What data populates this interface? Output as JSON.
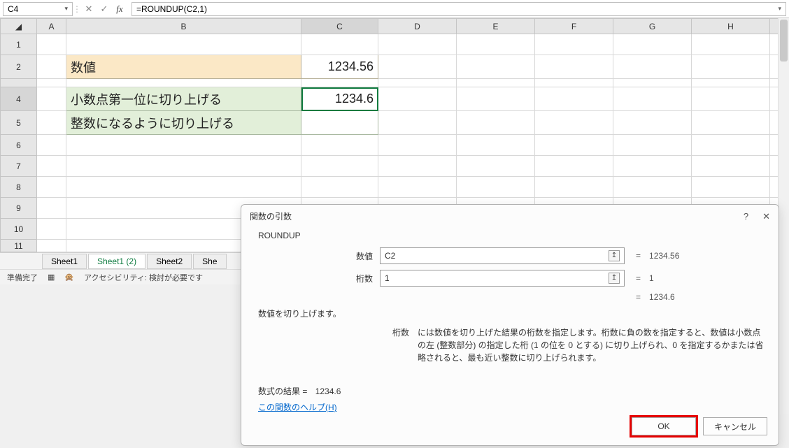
{
  "formula_bar": {
    "name_box": "C4",
    "formula": "=ROUNDUP(C2,1)"
  },
  "cells": {
    "B2": "数値",
    "C2": "1234.56",
    "B4": "小数点第一位に切り上げる",
    "C4": "1234.6",
    "B5": "整数になるように切り上げる"
  },
  "sheet_tabs": {
    "s1": "Sheet1",
    "s2": "Sheet1 (2)",
    "s3": "Sheet2",
    "s4": "She"
  },
  "status": {
    "ready": "準備完了",
    "access": "アクセシビリティ: 検討が必要です"
  },
  "dialog": {
    "title": "関数の引数",
    "fn_name": "ROUNDUP",
    "arg1_label": "数値",
    "arg1_value": "C2",
    "arg1_result": "1234.56",
    "arg2_label": "桁数",
    "arg2_value": "1",
    "arg2_result": "1",
    "calc_result": "1234.6",
    "desc": "数値を切り上げます。",
    "detail_label": "桁数",
    "detail_text": "には数値を切り上げた結果の桁数を指定します。桁数に負の数を指定すると、数値は小数点の左 (整数部分) の指定した桁 (1 の位を 0 とする) に切り上げられ、0 を指定するかまたは省略されると、最も近い整数に切り上げられます。",
    "result_label": "数式の結果 =",
    "result_value": "1234.6",
    "help": "この関数のヘルプ(H)",
    "ok": "OK",
    "cancel": "キャンセル"
  },
  "col_headers": {
    "A": "A",
    "B": "B",
    "C": "C",
    "D": "D",
    "E": "E",
    "F": "F",
    "G": "G",
    "H": "H"
  },
  "row_headers": {
    "r1": "1",
    "r2": "2",
    "r3": "",
    "r4": "4",
    "r5": "5",
    "r6": "6",
    "r7": "7",
    "r8": "8",
    "r9": "9",
    "r10": "10",
    "r11": "11"
  }
}
